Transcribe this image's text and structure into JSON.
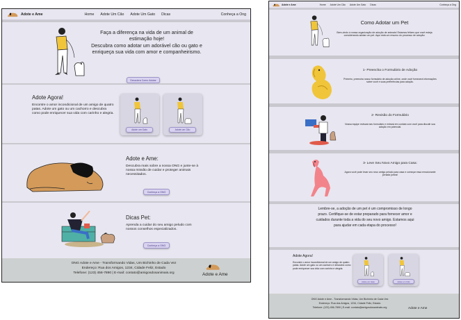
{
  "brand": "Adote e Ame",
  "nav": {
    "links": [
      "Home",
      "Adote Um Cão",
      "Adote Um Gato",
      "Dicas"
    ],
    "cta": "Conheça a Ong"
  },
  "hero": {
    "title": "Faça a diferença na vida de um animal de estimação hoje!",
    "text": "Descubra como adotar um adorável cão ou gato e enriqueça sua vida com amor e companheirismo.",
    "button": "Descubra Como Adotar"
  },
  "adopt": {
    "title": "Adote Agora!",
    "text": "Encontre o amor incondicional de um amigo de quatro patas. Adote um gato ou um cachorro e descubra como pode enriquecer sua vida com carinho e alegria.",
    "cat_button": "Adote um Gato",
    "dog_button": "Adote um Cão"
  },
  "about": {
    "title": "Adote e Ame:",
    "text": "Descubra mais sobre a nossa ONG e junte-se à nossa missão de cuidar e proteger animais necessitados.",
    "button": "Conheça a ONG"
  },
  "tips": {
    "title": "Dicas Pet:",
    "text": "Aprenda a cuidar do seu amigo peludo com nossos conselhos especializados.",
    "button": "Conheça a ONG"
  },
  "footer": {
    "line1": "ONG Adote e Ame - Transformando Vidas, Um Bichinho de Cada Vez",
    "line2": "Endereço: Rua dos Amigos, 1234, Cidade Feliz, Estado",
    "line3": "Telefone: (123) 456-7890 | E-mail: contato@amigosdosanimais.org",
    "brand": "Adote e Ame"
  },
  "how": {
    "title": "Como Adotar um Pet",
    "intro": "Bem-vindo à nossa organização de adoção de animais! Estamos felizes que você esteja considerando adotar um pet. Aqui está um resumo do processo de adoção:",
    "step1_title": "1- Preencha o Formulário de Adoção",
    "step1_text": "Primeiro, preencha nosso formulário de adoção online, onde você fornecerá informações sobre você e suas preferências para adoção.",
    "step2_title": "2- Revisão do Formulário",
    "step2_text": "Nossa equipe revisará seu formulário e entrará em contato com você para discutir sua adoção em potencial.",
    "step3_title": "3- Leve Seu Novo Amigo para Casa:",
    "step3_text": "Agora você pode levar seu novo amigo peludo para casa e começar essa emocionante jornada juntos!",
    "closing": "Lembre-se, a adoção de um pet é um compromisso de longo prazo. Certifique-se de estar preparado para fornecer amor e cuidados durante toda a vida do seu novo amigo. Estamos aqui para ajudar em cada etapa do processo!"
  },
  "colors": {
    "accent": "#4a3f86",
    "button_bg": "#d9d3f0",
    "section_bg": "#e8e6f0",
    "footer_bg": "#cdd0d0",
    "dog_tan": "#d39a5a",
    "yellow": "#f0c53a",
    "pink": "#f3838b"
  }
}
